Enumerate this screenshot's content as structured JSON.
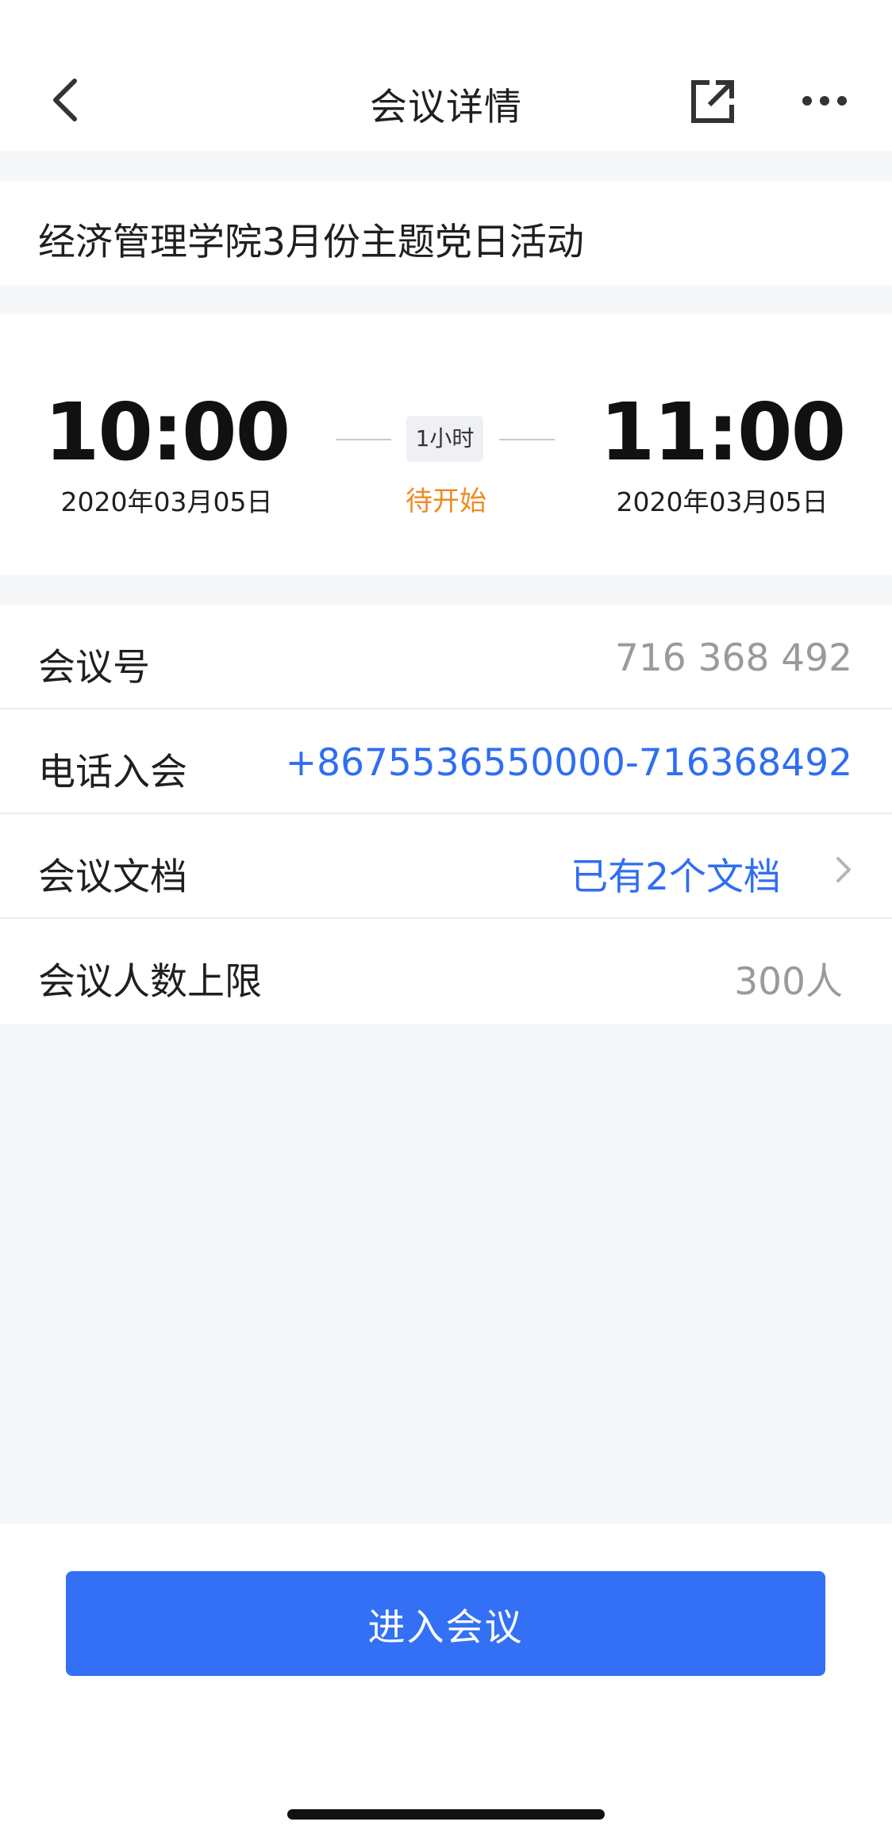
{
  "nav": {
    "title": "会议详情",
    "icons": {
      "back": "chevron-left-icon",
      "share": "external-link-icon",
      "more": "more-dots-icon"
    }
  },
  "meeting": {
    "title": "经济管理学院3月份主题党日活动",
    "start_time": "10:00",
    "start_date": "2020年03月05日",
    "end_time": "11:00",
    "end_date": "2020年03月05日",
    "duration": "1小时",
    "status": "待开始"
  },
  "info": {
    "meeting_id_label": "会议号",
    "meeting_id_value": "716 368 492",
    "phone_label": "电话入会",
    "phone_value": "+8675536550000-716368492",
    "docs_label": "会议文档",
    "docs_value": "已有2个文档",
    "limit_label": "会议人数上限",
    "limit_value": "300人"
  },
  "actions": {
    "enter_label": "进入会议"
  },
  "colors": {
    "accent": "#3370f5",
    "link": "#2f6ef2",
    "status": "#f08a24"
  }
}
